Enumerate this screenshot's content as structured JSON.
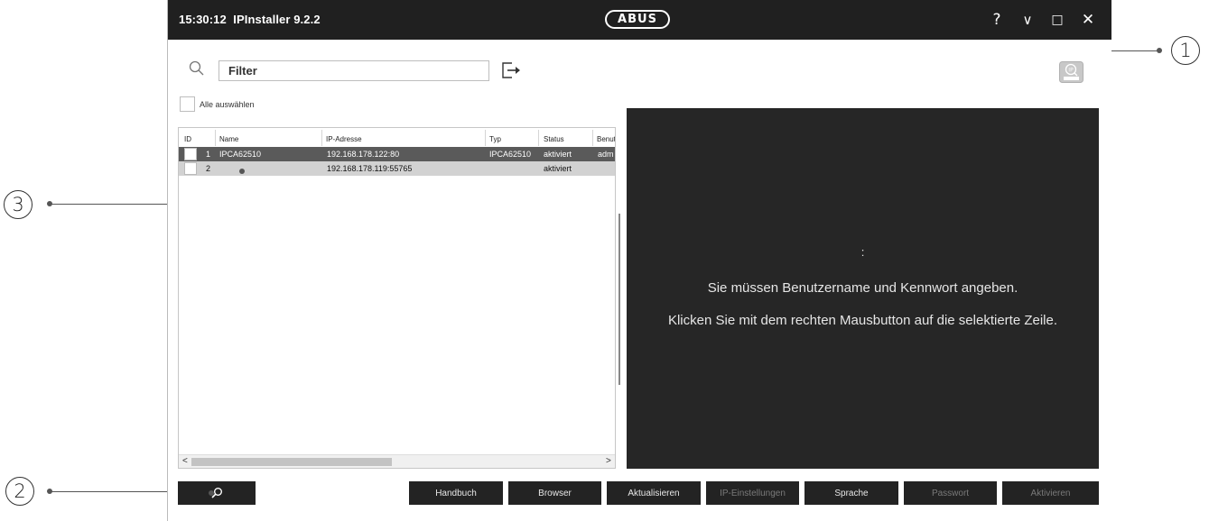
{
  "window": {
    "time": "15:30:12",
    "app_name": "IPInstaller 9.2.2",
    "logo_text": "ABUS",
    "help_label": "?",
    "minimize_label": "∨",
    "maximize_label": "□",
    "close_label": "✕"
  },
  "callouts": {
    "one": "1",
    "two": "2",
    "three": "3"
  },
  "filter": {
    "placeholder": "Filter",
    "value": ""
  },
  "select_all_label": "Alle auswählen",
  "table": {
    "columns": [
      "ID",
      "Name",
      "IP-Adresse",
      "Typ",
      "Status",
      "Benut"
    ],
    "rows": [
      {
        "id": "1",
        "name": "IPCA62510",
        "ip": "192.168.178.122:80",
        "type": "IPCA62510",
        "status": "aktiviert",
        "user": "adm"
      },
      {
        "id": "2",
        "name": "",
        "ip": "192.168.178.119:55765",
        "type": "",
        "status": "aktiviert",
        "user": ""
      }
    ],
    "scroll_left": "<",
    "scroll_right": ">"
  },
  "preview": {
    "colon": ":",
    "message1": "Sie müssen Benutzername und Kennwort angeben.",
    "message2": "Klicken Sie mit dem rechten Mausbutton auf die selektierte Zeile."
  },
  "buttons": {
    "search_icon": "⚲",
    "handbuch": "Handbuch",
    "browser": "Browser",
    "aktualisieren": "Aktualisieren",
    "ip_einstellungen": "IP-Einstellungen",
    "sprache": "Sprache",
    "passwort": "Passwort",
    "aktivieren": "Aktivieren"
  },
  "colors": {
    "titlebar": "#202020",
    "selected_row": "#5a5a5a",
    "row2": "#d2d2d2",
    "preview": "#262626",
    "button": "#232323"
  },
  "icons": [
    "search-icon",
    "export-icon",
    "ip-tool-icon",
    "help-icon",
    "minimize-icon",
    "maximize-icon",
    "close-icon"
  ]
}
